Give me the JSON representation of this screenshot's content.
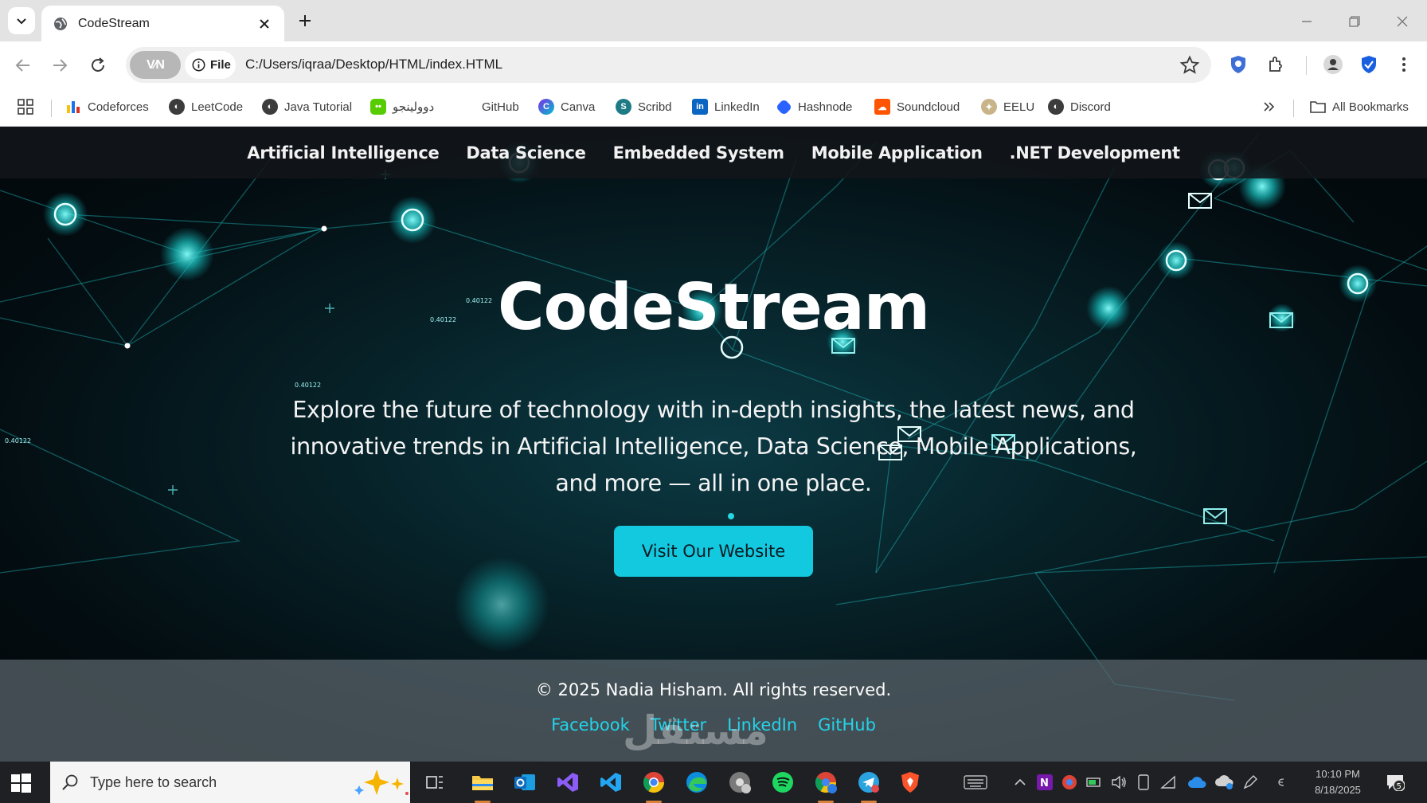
{
  "browser": {
    "tab": {
      "title": "CodeStream"
    },
    "omnibox": {
      "vpn_label": "V⁄N",
      "scheme_label": "File",
      "url": "C:/Users/iqraa/Desktop/HTML/index.HTML"
    },
    "bookmarks": [
      {
        "label": "Codeforces",
        "icon": "codeforces-icon"
      },
      {
        "label": "LeetCode",
        "icon": "globe-icon"
      },
      {
        "label": "Java Tutorial",
        "icon": "globe-icon"
      },
      {
        "label": "دوولينجو",
        "icon": "duolingo-icon"
      },
      {
        "label": "GitHub",
        "icon": "none"
      },
      {
        "label": "Canva",
        "icon": "canva-icon"
      },
      {
        "label": "Scribd",
        "icon": "scribd-icon"
      },
      {
        "label": "LinkedIn",
        "icon": "linkedin-icon"
      },
      {
        "label": "Hashnode",
        "icon": "hashnode-icon"
      },
      {
        "label": "Soundcloud",
        "icon": "soundcloud-icon"
      },
      {
        "label": "EELU",
        "icon": "eelu-icon"
      },
      {
        "label": "Discord",
        "icon": "globe-icon"
      }
    ],
    "all_bookmarks_label": "All Bookmarks"
  },
  "site": {
    "nav": [
      "Artificial Intelligence",
      "Data Science",
      "Embedded System",
      "Mobile Application",
      ".NET Development"
    ],
    "hero": {
      "title": "CodeStream",
      "lines": [
        "Explore the future of technology with in-depth insights, the latest news, and",
        "innovative trends in Artificial Intelligence, Data Science, Mobile Applications,",
        "and more — all in one place."
      ],
      "cta_label": "Visit Our Website"
    },
    "footer": {
      "copyright": "© 2025 Nadia Hisham. All rights reserved.",
      "links": [
        "Facebook",
        "Twitter",
        "LinkedIn",
        "GitHub"
      ],
      "watermark": "مستقل"
    },
    "bg_labels": [
      "0.40122",
      "0.40122",
      "0.40122",
      "0.40122"
    ],
    "colors": {
      "accent": "#13c9e0",
      "link": "#24d3ea",
      "nav_bg": "#12161a"
    }
  },
  "taskbar": {
    "search_placeholder": "Type here to search",
    "clock_time": "10:10 PM",
    "clock_date": "8/18/2025",
    "notification_count": "5",
    "apps": [
      "task-view-icon",
      "file-explorer-icon",
      "outlook-icon",
      "visual-studio-icon",
      "vscode-icon",
      "chrome-icon",
      "edge-icon",
      "chrome-profile-icon",
      "spotify-icon",
      "chrome-work-icon",
      "telegram-icon",
      "brave-icon"
    ]
  }
}
